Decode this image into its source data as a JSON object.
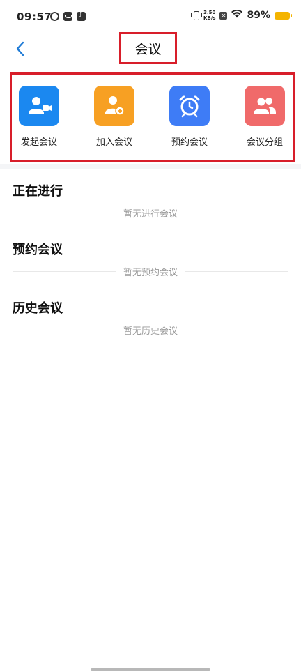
{
  "status_bar": {
    "time": "09:57",
    "net_speed_value": "3.50",
    "net_speed_unit": "KB/s",
    "battery_percent": "89%",
    "battery_color": "#f4b400"
  },
  "nav": {
    "title": "会议",
    "back_icon": "chevron-left-icon"
  },
  "actions": [
    {
      "label": "发起会议",
      "icon": "video-user-icon",
      "color": "#1b88f0"
    },
    {
      "label": "加入会议",
      "icon": "user-add-icon",
      "color": "#f7a023"
    },
    {
      "label": "预约会议",
      "icon": "alarm-clock-icon",
      "color": "#3e7cf6"
    },
    {
      "label": "会议分组",
      "icon": "group-users-icon",
      "color": "#f06a6a"
    }
  ],
  "sections": [
    {
      "title": "正在进行",
      "empty_text": "暂无进行会议"
    },
    {
      "title": "预约会议",
      "empty_text": "暂无预约会议"
    },
    {
      "title": "历史会议",
      "empty_text": "暂无历史会议"
    }
  ],
  "highlight_color": "#d81e2a"
}
